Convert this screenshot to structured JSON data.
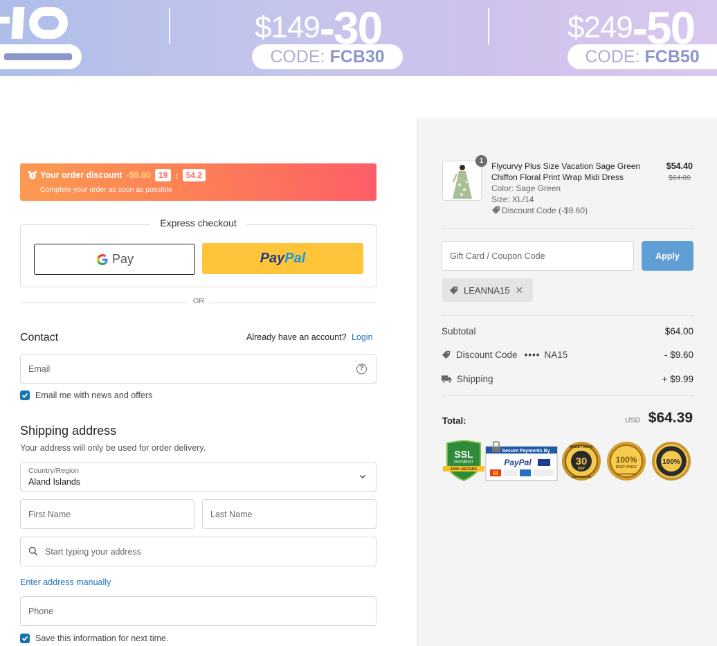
{
  "banner": {
    "promos": [
      {
        "price": "$149",
        "discount": "-30",
        "code_prefix": "CODE:",
        "code": "FCB30"
      },
      {
        "price": "$249",
        "discount": "-50",
        "code_prefix": "CODE:",
        "code": "FCB50"
      }
    ],
    "colors": {
      "gradient_start": "#aebee9",
      "gradient_end": "#d8c8ee",
      "code_text": "#8d96c8"
    }
  },
  "timer": {
    "title": "Your order discount",
    "amount": "-$9.60",
    "minutes": "19",
    "separator": ":",
    "seconds": "54.2",
    "subtitle": "Complete your order as soon as possible"
  },
  "express": {
    "title": "Express checkout",
    "gpay_label": "Pay",
    "paypal_pay": "Pay",
    "paypal_pal": "Pal",
    "or_label": "OR"
  },
  "contact": {
    "heading": "Contact",
    "account_prompt": "Already have an account?",
    "login_label": "Login",
    "email_placeholder": "Email",
    "newsletter_label": "Email me with news and offers",
    "newsletter_checked": true
  },
  "shipping": {
    "heading": "Shipping address",
    "subtitle": "Your address will only be used for order delivery.",
    "country_label": "Country/Region",
    "country_value": "Aland Islands",
    "first_name_placeholder": "First Name",
    "last_name_placeholder": "Last Name",
    "address_placeholder": "Start typing your address",
    "manual_link": "Enter address manually",
    "phone_placeholder": "Phone",
    "save_label": "Save this information for next time.",
    "save_checked": true
  },
  "summary": {
    "item": {
      "quantity": "1",
      "name": "Flycurvy Plus Size Vacation Sage Green Chiffon Floral Print Wrap Midi Dress",
      "color": "Color: Sage Green",
      "size": "Size: XL/14",
      "discount": "Discount Code (-$9.60)",
      "price": "$54.40",
      "original_price": "$64.00"
    },
    "coupon_placeholder": "Gift Card / Coupon Code",
    "apply_label": "Apply",
    "applied_code": "LEANNA15",
    "subtotal_label": "Subtotal",
    "subtotal_value": "$64.00",
    "discount_label": "Discount Code",
    "discount_dots": "••••",
    "discount_code_tail": "NA15",
    "discount_value": "- $9.60",
    "shipping_label": "Shipping",
    "shipping_value": "+ $9.99",
    "total_label": "Total:",
    "total_currency": "USD",
    "total_value": "$64.39",
    "trust_badges": {
      "ssl_title": "SSL",
      "ssl_sub": "PAYMENT",
      "ssl_ribbon": "100% SECURE",
      "secure_header": "Secure Payments By",
      "secure_paypal": "PayPal",
      "money_back_top": "MONEY BACK",
      "money_back_num": "30",
      "money_back_mid": "DAY",
      "money_back_bottom": "GUARANTEE",
      "best_price_num": "100%",
      "best_price_mid": "BEST PRICE",
      "best_price_bottom": "GUARANTEE",
      "satisfaction_num": "100%"
    },
    "accent_color": "#5f9fd6"
  }
}
